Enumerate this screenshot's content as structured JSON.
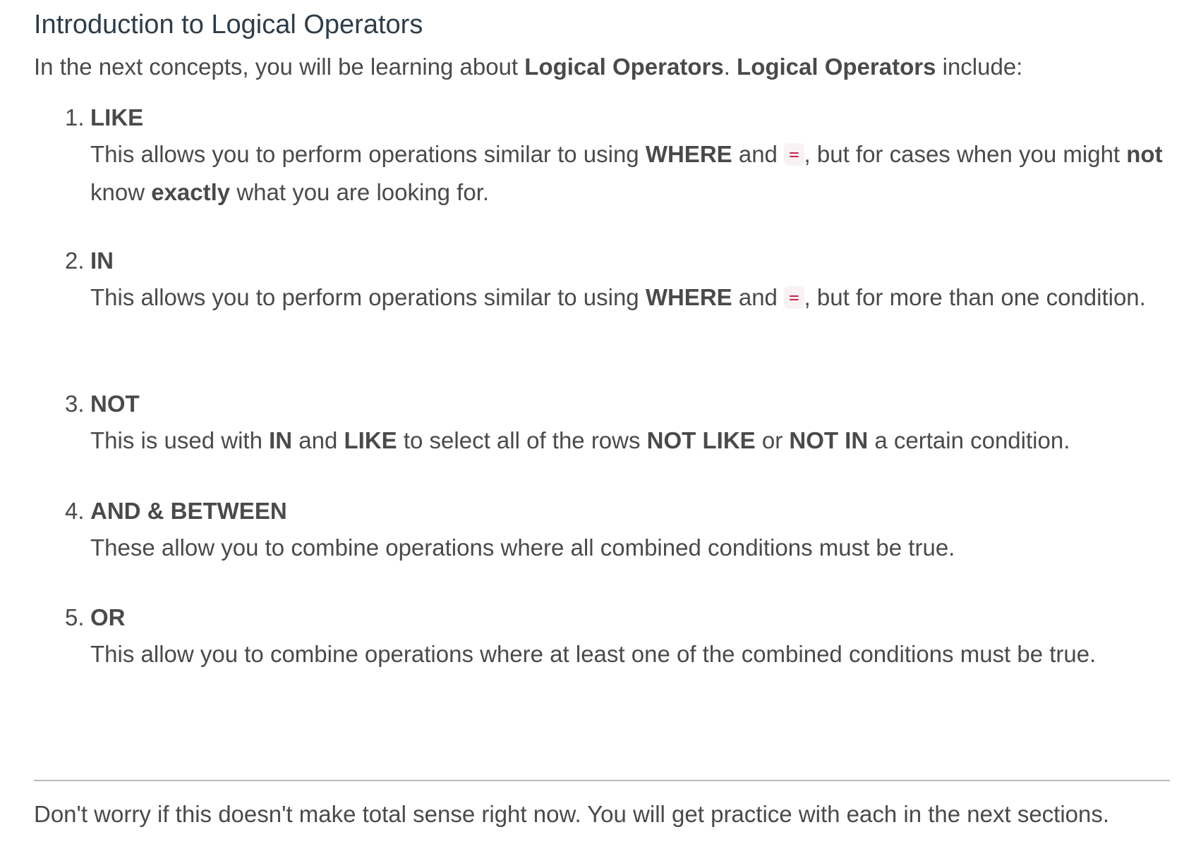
{
  "title": "Introduction to Logical Operators",
  "intro": {
    "prefix": "In the next concepts, you will be learning about ",
    "bold1": "Logical Operators",
    "mid": ". ",
    "bold2": "Logical Operators",
    "suffix": " include:"
  },
  "items": [
    {
      "number": "1.",
      "name": "LIKE",
      "desc": {
        "t1": "This allows you to perform operations similar to using ",
        "b1": "WHERE",
        "t2": " and ",
        "code": "=",
        "t3": ", but for cases when you might ",
        "b2": "not",
        "t4": " know ",
        "b3": "exactly",
        "t5": " what you are looking for."
      }
    },
    {
      "number": "2.",
      "name": "IN",
      "desc": {
        "t1": "This allows you to perform operations similar to using ",
        "b1": "WHERE",
        "t2": " and ",
        "code": "=",
        "t3": ", but for more than one condition."
      }
    },
    {
      "number": "3.",
      "name": "NOT",
      "desc": {
        "t1": "This is used with ",
        "b1": "IN",
        "t2": " and ",
        "b2": "LIKE",
        "t3": " to select all of the rows ",
        "b3": "NOT LIKE",
        "t4": " or ",
        "b4": "NOT IN",
        "t5": " a certain condition."
      }
    },
    {
      "number": "4.",
      "name": "AND & BETWEEN",
      "desc": {
        "t1": "These allow you to combine operations where all combined conditions must be true."
      }
    },
    {
      "number": "5.",
      "name": "OR",
      "desc": {
        "t1": "This allow you to combine operations where at least one of the combined conditions must be true."
      }
    }
  ],
  "footer": "Don't worry if this doesn't make total sense right now. You will get practice with each in the next sections.",
  "colors": {
    "title": "#2e3d49",
    "body_text": "#4a4a4a",
    "code_text": "#c7254e",
    "code_bg": "#f9f2f4",
    "divider": "#b9b9b9"
  }
}
